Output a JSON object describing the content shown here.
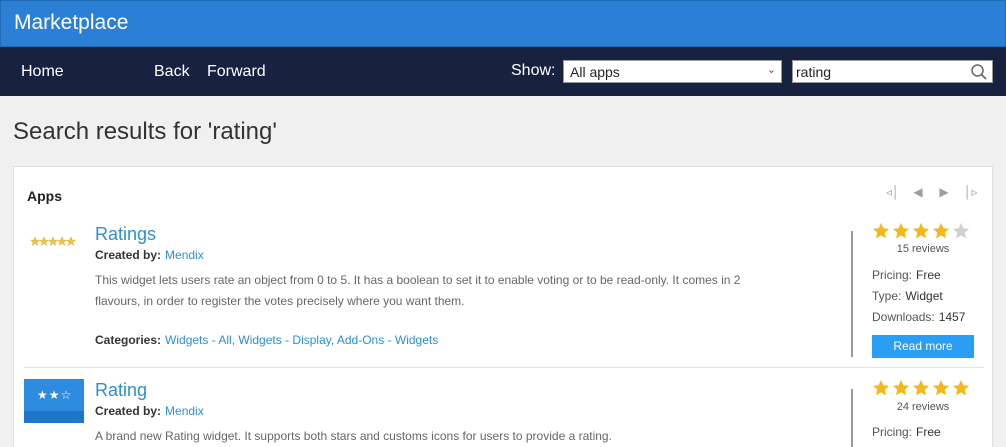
{
  "app": {
    "title": "Marketplace"
  },
  "nav": {
    "home": "Home",
    "back": "Back",
    "forward": "Forward",
    "show_label": "Show:"
  },
  "filter": {
    "selected": "All apps"
  },
  "search": {
    "value": "rating"
  },
  "page_title": "Search results for 'rating'",
  "panel": {
    "label": "Apps"
  },
  "items": [
    {
      "name": "Ratings",
      "created_label": "Created by:",
      "creator": "Mendix",
      "description_line1": "This widget lets users rate an object from 0 to 5. It has a boolean to set it to enable voting or to be read-only. It comes in 2",
      "description_line2": "flavours, in order to register the votes precisely where you want them.",
      "categories_label": "Categories:",
      "categories": "Widgets - All, Widgets - Display, Add-Ons - Widgets",
      "rating": 4,
      "reviews": "15 reviews",
      "pricing_label": "Pricing:",
      "pricing": "Free",
      "type_label": "Type:",
      "type": "Widget",
      "downloads_label": "Downloads:",
      "downloads": "1457",
      "read_more": "Read more"
    },
    {
      "name": "Rating",
      "created_label": "Created by:",
      "creator": "Mendix",
      "description_line1": "A brand new Rating widget. It supports both stars and customs icons for users to provide a rating.",
      "rating": 5,
      "reviews": "24 reviews",
      "pricing_label": "Pricing:",
      "pricing": "Free"
    }
  ],
  "colors": {
    "header": "#2b7fd4",
    "nav": "#172240",
    "link": "#2b8fd6",
    "star": "#f5b81c",
    "button": "#2a9df4"
  }
}
